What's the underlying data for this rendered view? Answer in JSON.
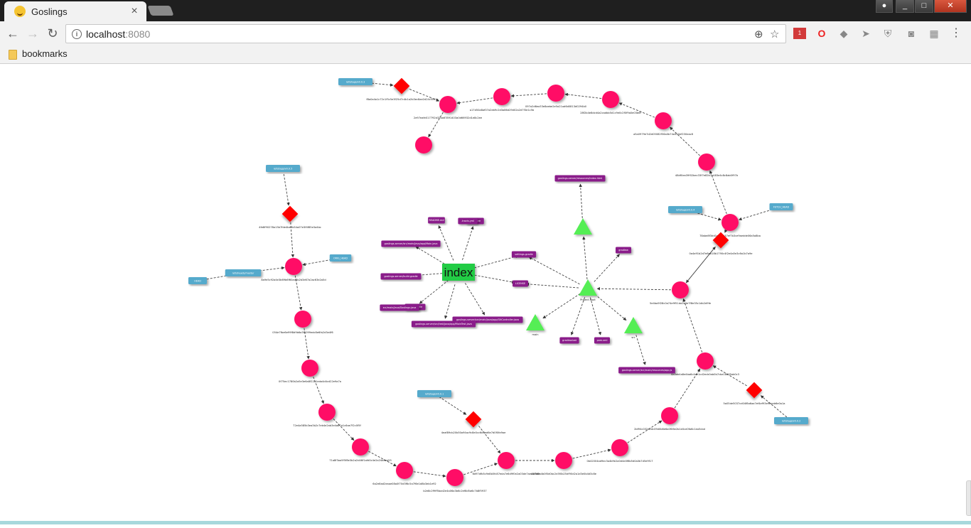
{
  "browser": {
    "tab_title": "Goslings",
    "tab_close": "×",
    "url_host": "localhost",
    "url_port": ":8080",
    "bookmarks_label": "bookmarks",
    "back": "←",
    "forward": "→",
    "reload": "↻",
    "zoom": "⊕",
    "star": "☆",
    "menu": "⋮",
    "info": "i",
    "extension_badge": "1",
    "win_min": "_",
    "win_max": "□",
    "win_close": "✕"
  },
  "colors": {
    "commit": "#ff1166",
    "tree": "#55ee55",
    "blob": "#8a1a8a",
    "tag": "#ff0000",
    "ref": "#55aacc",
    "index": "#22cc44",
    "edge": "#444444"
  },
  "graph": {
    "index_label": "index",
    "nodes": [
      {
        "id": "tag1",
        "type": "tag",
        "label": "f8a0a4a1c72c1f5c5e3f25d7c4b1a2b3ec8ae2d24c5c03"
      },
      {
        "id": "c1",
        "type": "commit",
        "label": "2e97eafe017792b32aa67891403a0d66932d1e8c2ee"
      },
      {
        "id": "c2",
        "type": "commit",
        "label": "a17d50a8af07a2eb9c2d3a86d29d02a2d7f3e1c5b"
      },
      {
        "id": "c3",
        "type": "commit",
        "label": ""
      },
      {
        "id": "c4",
        "type": "commit",
        "label": "097a2d6ea33e8aebe2e5a21ad6d0813d0294b0"
      },
      {
        "id": "c5",
        "type": "commit",
        "label": "28f2b4e8dcd4a2cadbb5d1c9e0c2f0f9a0e03b6f"
      },
      {
        "id": "c6",
        "type": "commit",
        "label": "a5a0979e7d2d05082f56a0b74a320ef230eac8"
      },
      {
        "id": "c7",
        "type": "commit",
        "label": "48df0ea39f02bec33f7e82b7e483e4c8c8ab0f97b"
      },
      {
        "id": "c8",
        "type": "commit",
        "label": "78abe8f3dd1e2a9b37ef7b3ce9aedde06a5a8ba"
      },
      {
        "id": "c9",
        "type": "commit",
        "label": "1ab38a5b9c5a0b44e6ebe4f49d37cbd1cda9e1f"
      },
      {
        "id": "c10",
        "type": "commit",
        "label": "2a8bb6e4f1a71c23c4a0d1e6d5e8b4a90f2b5aa8e3"
      },
      {
        "id": "c0",
        "type": "commit",
        "label": "5e4ba5f28c0a74e9f51da2b3e7f8e35c1db2d9fe"
      },
      {
        "id": "tag2",
        "type": "tag",
        "label": "0a4a91b2d7e8ab18b1790c4f2e4a5e3c6a1b7a9e"
      },
      {
        "id": "l1",
        "type": "commit",
        "label": "8a9e5c92a4e3b69b6f60ad3b2b3e67a2ac63e2a5d"
      },
      {
        "id": "l2",
        "type": "commit",
        "label": "054e7fbe6e99f8d9b6a3f5099edc8e6fa2d3e4f6"
      },
      {
        "id": "l3",
        "type": "commit",
        "label": "0f75ec1780b2a5e3e6a8f22a1eda4d4cd22e9a7a"
      },
      {
        "id": "l4",
        "type": "commit",
        "label": "72e4a585b3ea3b2c7eb4e2ab3e4a87a1c6ae7f2c0f5f"
      },
      {
        "id": "l5",
        "type": "commit",
        "label": "71a8f3aa5f5f8e3b2a2d46f1afd0c4e2a24d8ea55"
      },
      {
        "id": "l6",
        "type": "commit",
        "label": "6a2e8ad2eaae08a0f70d3f6c5a7f6e1d8b3eb1e92"
      },
      {
        "id": "l7",
        "type": "commit",
        "label": "b2e8c2f9ff5bad2e4a06a3b6c2ef8d5a6c7b8f5937"
      },
      {
        "id": "b1",
        "type": "commit",
        "label": "6d97dfb5c9e8b5fc87eda7e6d9f0e2a03de7aec4f64d"
      },
      {
        "id": "b2",
        "type": "commit",
        "label": "4b7b6a4b0f0d0bc2e3f0b25df90d2a1d3e0b4d3c8e"
      },
      {
        "id": "b3",
        "type": "commit",
        "label": "0b42004ad9ec3a4b9e2a0d4e0f8b5d0a0b7d5e9f17"
      },
      {
        "id": "b4",
        "type": "commit",
        "label": "2bf94c032a2dc09d0b6e6a0f06e2b1e0ce0fa6c1ea5cbd"
      },
      {
        "id": "b5",
        "type": "commit",
        "label": "4a3ab4a8e4ba6c4de1cd2ecb0ab0b7cba18d35ab0c3"
      },
      {
        "id": "b6",
        "type": "commit",
        "label": "9283a33e6d9f1e8d8e9fb2dd2e9c7ecc6d48e8ab08fd2"
      },
      {
        "id": "tag3",
        "type": "tag",
        "label": "4fe8f90278a13b7fde4be2b54a07e3f4f85e3a4bc"
      },
      {
        "id": "tag4",
        "type": "tag",
        "label": "4eaf89cb20b50a94ac9c8e0cc6d3ed6e7d0f0fa9ae"
      },
      {
        "id": "tag5",
        "type": "tag",
        "label": "5a05de5037cd04f8a6aa7ef4ef93e9eeeb6e0a1a"
      },
      {
        "id": "ref1",
        "type": "ref",
        "label": "refs/tags/v0.0.3"
      },
      {
        "id": "ref2",
        "type": "ref",
        "label": "refs/tags/v0.0.5"
      },
      {
        "id": "ref3",
        "type": "ref",
        "label": "refs/heads/master"
      },
      {
        "id": "ref4",
        "type": "ref",
        "label": "ORIG_HEAD"
      },
      {
        "id": "ref5",
        "type": "ref",
        "label": "HEAD"
      },
      {
        "id": "ref6",
        "type": "ref",
        "label": "refs/tags/v0.0.1"
      },
      {
        "id": "ref7",
        "type": "ref",
        "label": "refs/tags/v0.0.4"
      },
      {
        "id": "ref8",
        "type": "ref",
        "label": "FETCH_HEAD"
      },
      {
        "id": "ref9",
        "type": "ref",
        "label": "refs/tags/v0.0.2"
      },
      {
        "id": "t1",
        "type": "tree",
        "label": ""
      },
      {
        "id": "t2",
        "type": "tree",
        "label": "main"
      },
      {
        "id": "t3",
        "type": "tree",
        "label": "Project.Root"
      },
      {
        "id": "t4",
        "type": "tree",
        "label": "src"
      },
      {
        "id": "t5",
        "type": "tree",
        "label": "web"
      },
      {
        "id": "blob1",
        "type": "blob",
        "label": "goslings-server/resources/index.html"
      },
      {
        "id": "blob2",
        "type": "blob",
        "label": "README.md"
      },
      {
        "id": "blob3",
        "type": "blob",
        "label": ".gitignore"
      },
      {
        "id": "blob4",
        "type": "blob",
        "label": "goslings-server/src/main/java/app/Main.java"
      },
      {
        "id": "blob5",
        "type": "blob",
        "label": "goslings-server/build.gradle"
      },
      {
        "id": "blob6",
        "type": "blob",
        "label": "settings.gradle"
      },
      {
        "id": "blob7",
        "type": "blob",
        "label": "LICENSE"
      },
      {
        "id": "blob8",
        "type": "blob",
        "label": "goslings-server/src/main/java/app/GitController.java"
      },
      {
        "id": "blob9",
        "type": "blob",
        "label": "goslings-server/src/test/java/app/MainTest.java"
      },
      {
        "id": "blob10",
        "type": "blob",
        "label": "build.gradle"
      },
      {
        "id": "blob11",
        "type": "blob",
        "label": "gradlew"
      },
      {
        "id": "blob12",
        "type": "blob",
        "label": "gradlew.bat"
      },
      {
        "id": "blob13",
        "type": "blob",
        "label": "goslings-server/src/main/resources/app.js"
      },
      {
        "id": "blob14",
        "type": "blob",
        "label": "pom.xml"
      },
      {
        "id": "blob15",
        "type": "blob",
        "label": "src/main/java/Goslings.java"
      },
      {
        "id": "blob16",
        "type": "blob",
        "label": ".travis.yml"
      }
    ]
  }
}
